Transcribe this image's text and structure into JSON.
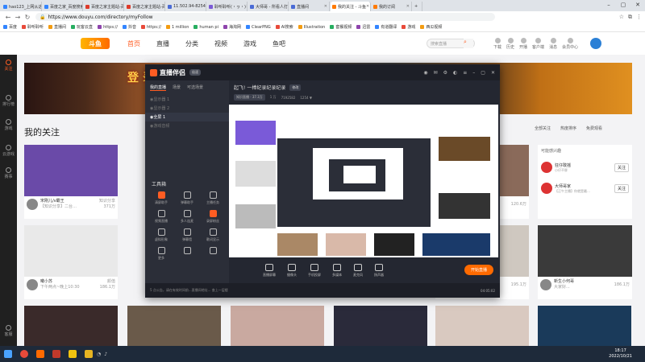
{
  "browser": {
    "tabs": [
      {
        "label": "hao123_上网从这里开始",
        "color": "#3385ff"
      },
      {
        "label": "百度之家_百度搜索",
        "color": "#3385ff"
      },
      {
        "label": "百度之家主题站-百度",
        "color": "#de3b2b"
      },
      {
        "label": "百度之家主题站-百度",
        "color": "#de3b2b"
      },
      {
        "label": "11.502.94-8254.75",
        "color": "#4a6bd6"
      },
      {
        "label": "聆听聆听(・ヮ・)",
        "color": "#7b5bd6"
      },
      {
        "label": "大师哥 - 所看人打",
        "color": "#4a6bd6"
      },
      {
        "label": "直播间",
        "color": "#4a6bd6"
      },
      {
        "label": "我的关注 - 斗鱼",
        "color": "#ff7a00"
      },
      {
        "label": "我的订阅",
        "color": "#ff7a00"
      }
    ],
    "active_tab_index": 8,
    "url": "https://www.douyu.com/directory/myFollow",
    "bookmarks": [
      "百度",
      "聆听聆听",
      "直播间",
      "玩客云直",
      "https://",
      "抖音",
      "https://",
      "1 million",
      "human pi",
      "海淘网",
      "ClearPNG",
      "AI搜索",
      "Illustration",
      "套餐视频",
      "迅雷",
      "有道翻译",
      "游戏",
      "西瓜视频"
    ]
  },
  "site": {
    "logo": "斗鱼",
    "nav": [
      "首页",
      "直播",
      "分类",
      "视频",
      "游戏",
      "鱼吧"
    ],
    "active_nav": 0,
    "search_placeholder": "搜索直播",
    "header_icons": [
      "下载",
      "历史",
      "开播",
      "客户端",
      "消息",
      "会员中心"
    ],
    "sidebar": [
      "关注",
      "排行榜",
      "游戏",
      "云游戏",
      "赛事"
    ],
    "sidebar_bottom": "客服",
    "banner_text": "登 录",
    "page_title": "我的关注",
    "filters": [
      "全部关注",
      "热度排序",
      "免费观看"
    ],
    "cards": [
      {
        "title": "宋刚儿/v霸王",
        "sub": "【知识分享】二台…",
        "tag": "知识分享",
        "count": "371万"
      },
      {
        "title": "曦小苏",
        "sub": "下午两点~晚上10:30",
        "tag": "颜值",
        "count": "186.1万"
      },
      {
        "title": "",
        "sub": "",
        "tag": "",
        "count": "120.6万"
      },
      {
        "title": "",
        "sub": "",
        "tag": "",
        "count": "195.1万"
      },
      {
        "title": "新生小何哥",
        "sub": "大家好...",
        "tag": "",
        "count": "186.1万"
      }
    ],
    "recommend": {
      "title": "可能感兴趣",
      "items": [
        {
          "name": "狂仔敢摇",
          "sub": "小仔不胖",
          "button": "关注"
        },
        {
          "name": "大师哥家",
          "sub": "【正午主播】你就是最…",
          "button": "关注"
        }
      ]
    }
  },
  "app": {
    "name": "直播伴侣",
    "version": "极速",
    "scene_tabs": [
      "我的直播",
      "场景",
      "可选场景"
    ],
    "scenes": [
      "显示器 1",
      "显示器 2",
      "全屏 1",
      "游戏音频"
    ],
    "selected_scene": 2,
    "tools_title": "工具箱",
    "tools": [
      "清屏助手",
      "弹幕助手",
      "主播任务",
      "视频直播",
      "多人连麦",
      "录屏粉丝",
      "虚拟形象",
      "弹幕墙",
      "歌词显示",
      "更多",
      "",
      ""
    ],
    "room_title": "起飞! 一棒纪录纪录纪录",
    "room_edit": "修改",
    "room_info": [
      "知识直播 · 37.3万",
      "1 万",
      "7192582",
      "1254 ▼"
    ],
    "bottom_buttons": [
      "直播屏幕",
      "摄像头",
      "手机投屏",
      "多媒体",
      "麦克风",
      "扬声器"
    ],
    "start_live": "开始直播",
    "status_text": "5 点公告，请在有效时间前...直播间地址... 查上一层楼",
    "status_time": "04:05:02"
  },
  "taskbar": {
    "time": "18:17",
    "date": "2022/10/21"
  }
}
